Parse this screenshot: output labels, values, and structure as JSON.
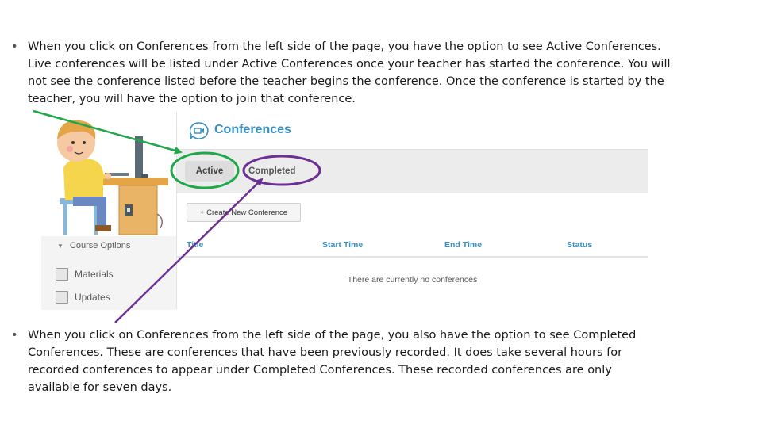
{
  "bullets": [
    {
      "marker": "•",
      "text": "When you click on Conferences from the left side of the page, you have the option to see Active Conferences. Live conferences will be listed under Active Conferences once your teacher has started the conference.  You will not see the conference listed before the teacher begins the conference.  Once the conference is started by the teacher, you will have the option to join that conference."
    },
    {
      "marker": "•",
      "text": "When you click on Conferences from the left side of the page, you also have the option to see Completed Conferences.  These are conferences that have been previously recorded.  It does take several hours for recorded conferences to appear under Completed Conferences.  These recorded conferences are only available for seven days."
    }
  ],
  "sidebar": {
    "course_options": "Course Options",
    "items": [
      {
        "label": "Materials",
        "icon": "materials-icon"
      },
      {
        "label": "Updates",
        "icon": "updates-icon"
      }
    ]
  },
  "conferences": {
    "title": "Conferences",
    "icon": "conference-video-icon",
    "tabs": {
      "active": "Active",
      "completed": "Completed"
    },
    "create_button": "+ Create New Conference",
    "columns": [
      "Title",
      "Start Time",
      "End Time",
      "Status"
    ],
    "empty_message": "There are currently no conferences"
  },
  "colors": {
    "accent": "#3a8fc2",
    "active_highlight": "#1fa84a",
    "completed_highlight": "#6b2f96"
  }
}
